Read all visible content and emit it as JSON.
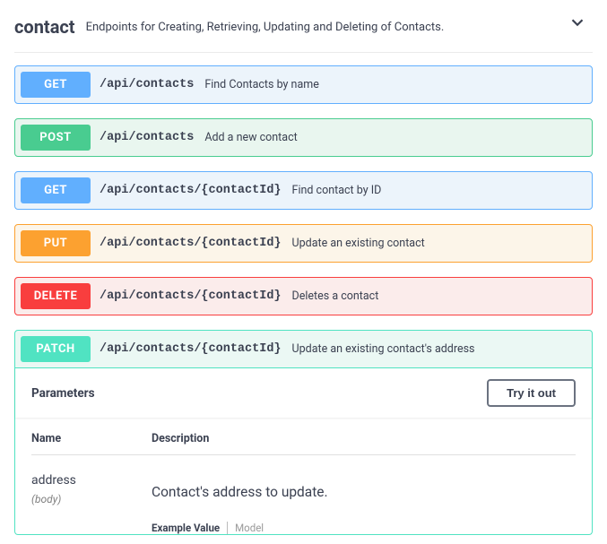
{
  "tag": {
    "name": "contact",
    "description": "Endpoints for Creating, Retrieving, Updating and Deleting of Contacts."
  },
  "endpoints": [
    {
      "method": "GET",
      "path": "/api/contacts",
      "summary": "Find Contacts by name"
    },
    {
      "method": "POST",
      "path": "/api/contacts",
      "summary": "Add a new contact"
    },
    {
      "method": "GET",
      "path": "/api/contacts/{contactId}",
      "summary": "Find contact by ID"
    },
    {
      "method": "PUT",
      "path": "/api/contacts/{contactId}",
      "summary": "Update an existing contact"
    },
    {
      "method": "DELETE",
      "path": "/api/contacts/{contactId}",
      "summary": "Deletes a contact"
    },
    {
      "method": "PATCH",
      "path": "/api/contacts/{contactId}",
      "summary": "Update an existing contact's address"
    }
  ],
  "expanded": {
    "parameters_label": "Parameters",
    "try_button": "Try it out",
    "columns": {
      "name": "Name",
      "description": "Description"
    },
    "param": {
      "name": "address",
      "in": "(body)",
      "description": "Contact's address to update."
    },
    "tabs": {
      "example": "Example Value",
      "model": "Model"
    }
  }
}
